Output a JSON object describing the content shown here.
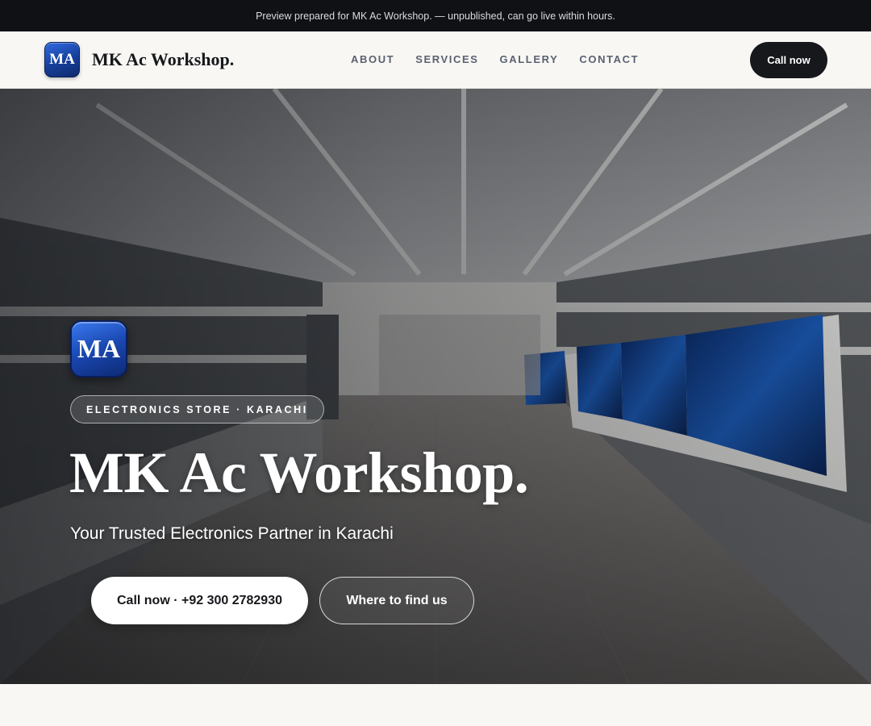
{
  "preview_banner": "Preview prepared for MK Ac Workshop. — unpublished, can go live within hours.",
  "header": {
    "logo_text": "MA",
    "brand": "MK Ac Workshop.",
    "nav": [
      "ABOUT",
      "SERVICES",
      "GALLERY",
      "CONTACT"
    ],
    "cta": "Call now"
  },
  "hero": {
    "logo_text": "MA",
    "eyebrow": "ELECTRONICS STORE · KARACHI",
    "title": "MK Ac Workshop.",
    "subtitle": "Your Trusted Electronics Partner in Karachi",
    "primary_button": "Call now · +92 300 2782930",
    "secondary_button": "Where to find us"
  },
  "colors": {
    "topbar": "#0f1115",
    "accent_dark": "#16181c",
    "logo_blue": "#1a47b0",
    "background": "#f8f7f4"
  }
}
